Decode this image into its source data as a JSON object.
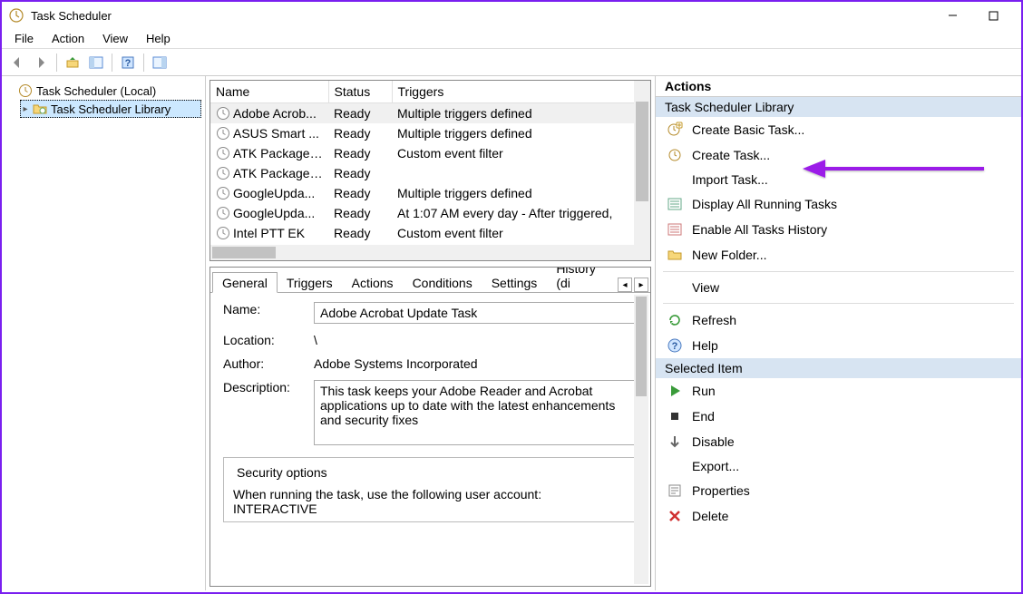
{
  "window": {
    "title": "Task Scheduler"
  },
  "menubar": {
    "file": "File",
    "action": "Action",
    "view": "View",
    "help": "Help"
  },
  "tree": {
    "root": "Task Scheduler (Local)",
    "child": "Task Scheduler Library"
  },
  "task_table": {
    "columns": {
      "name": "Name",
      "status": "Status",
      "triggers": "Triggers"
    },
    "rows": [
      {
        "name": "Adobe Acrob...",
        "status": "Ready",
        "triggers": "Multiple triggers defined"
      },
      {
        "name": "ASUS Smart ...",
        "status": "Ready",
        "triggers": "Multiple triggers defined"
      },
      {
        "name": "ATK Package ...",
        "status": "Ready",
        "triggers": "Custom event filter"
      },
      {
        "name": "ATK Package ...",
        "status": "Ready",
        "triggers": ""
      },
      {
        "name": "GoogleUpda...",
        "status": "Ready",
        "triggers": "Multiple triggers defined"
      },
      {
        "name": "GoogleUpda...",
        "status": "Ready",
        "triggers": "At 1:07 AM every day - After triggered,"
      },
      {
        "name": "Intel PTT EK",
        "status": "Ready",
        "triggers": "Custom event filter"
      }
    ]
  },
  "details": {
    "tabs": {
      "general": "General",
      "triggers": "Triggers",
      "actions": "Actions",
      "conditions": "Conditions",
      "settings": "Settings",
      "history": "History (di"
    },
    "labels": {
      "name": "Name:",
      "location": "Location:",
      "author": "Author:",
      "description": "Description:"
    },
    "name": "Adobe Acrobat Update Task",
    "location": "\\",
    "author": "Adobe Systems Incorporated",
    "description": "This task keeps your Adobe Reader and Acrobat applications up to date with the latest enhancements and security fixes",
    "security_title": "Security options",
    "security_line1": "When running the task, use the following user account:",
    "security_line2": "INTERACTIVE"
  },
  "actions_pane": {
    "header": "Actions",
    "group1": "Task Scheduler Library",
    "items1": [
      {
        "id": "create-basic-task",
        "label": "Create Basic Task...",
        "icon": "clock-new"
      },
      {
        "id": "create-task",
        "label": "Create Task...",
        "icon": "clock-gear"
      },
      {
        "id": "import-task",
        "label": "Import Task...",
        "icon": "blank"
      },
      {
        "id": "display-running",
        "label": "Display All Running Tasks",
        "icon": "list"
      },
      {
        "id": "enable-history",
        "label": "Enable All Tasks History",
        "icon": "history"
      },
      {
        "id": "new-folder",
        "label": "New Folder...",
        "icon": "folder"
      },
      {
        "id": "view",
        "label": "View",
        "icon": "blank"
      },
      {
        "id": "refresh",
        "label": "Refresh",
        "icon": "refresh"
      },
      {
        "id": "help",
        "label": "Help",
        "icon": "help"
      }
    ],
    "group2": "Selected Item",
    "items2": [
      {
        "id": "run",
        "label": "Run",
        "icon": "play"
      },
      {
        "id": "end",
        "label": "End",
        "icon": "stop"
      },
      {
        "id": "disable",
        "label": "Disable",
        "icon": "disable"
      },
      {
        "id": "export",
        "label": "Export...",
        "icon": "blank"
      },
      {
        "id": "properties",
        "label": "Properties",
        "icon": "props"
      },
      {
        "id": "delete",
        "label": "Delete",
        "icon": "delete"
      }
    ]
  }
}
